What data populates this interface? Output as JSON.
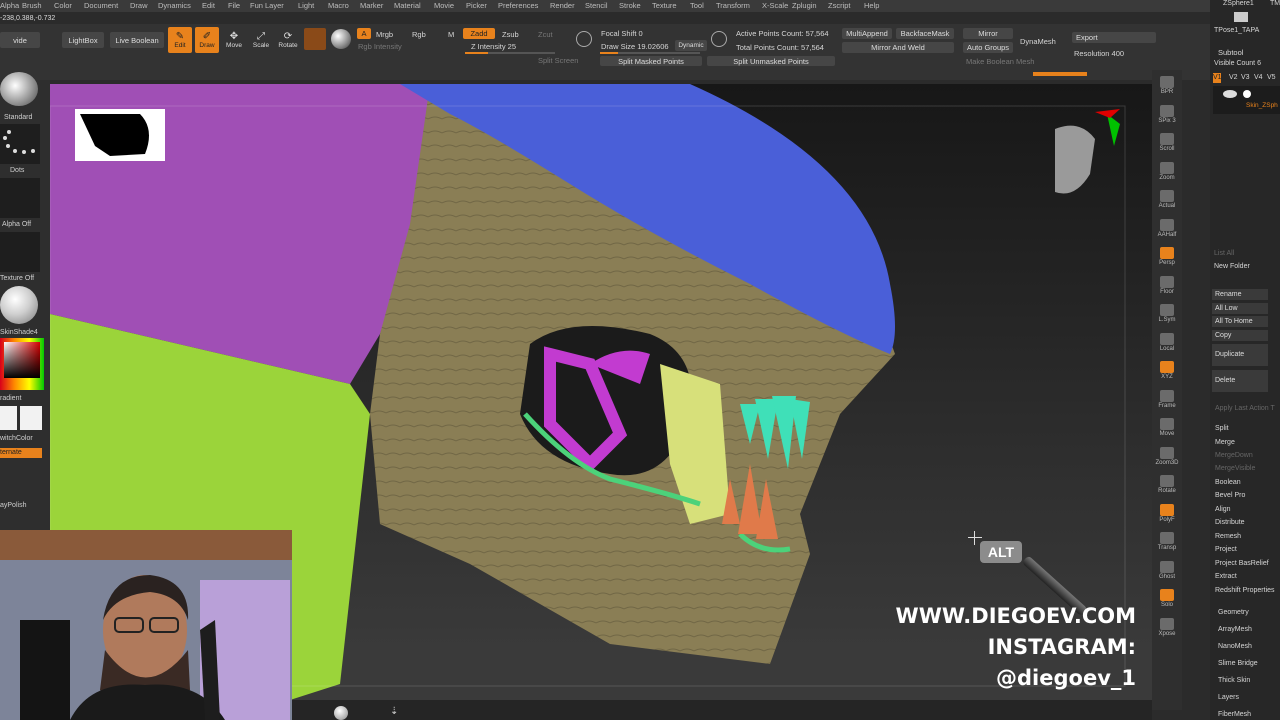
{
  "menu": [
    "Alpha",
    "Brush",
    "Color",
    "Document",
    "Draw",
    "Dynamics",
    "Edit",
    "File",
    "Fun Layer",
    "Light",
    "Macro",
    "Marker",
    "Material",
    "Movie",
    "Picker",
    "Preferences",
    "Render",
    "Stencil",
    "Stroke",
    "Texture",
    "Tool",
    "Transform",
    "X-Scale",
    "Zplugin",
    "Zscript",
    "Help"
  ],
  "coords": "-238,0.388,-0.732",
  "toolbar": {
    "divide": "vide",
    "lightbox": "LightBox",
    "live_boolean": "Live Boolean",
    "edit": "Edit",
    "draw": "Draw",
    "move": "Move",
    "scale": "Scale",
    "rotate": "Rotate",
    "a": "A",
    "mrgb": "Mrgb",
    "rgb": "Rgb",
    "m": "M",
    "rgb_intensity": "Rgb Intensity",
    "zadd": "Zadd",
    "zsub": "Zsub",
    "zcut": "Zcut",
    "z_intensity": "Z Intensity 25",
    "z_intensity_value": 0.25,
    "focal_shift": "Focal Shift 0",
    "draw_size": "Draw Size 19.02606",
    "dynamic": "Dynamic",
    "active_points": "Active Points Count: 57,564",
    "total_points": "Total Points Count: 57,564",
    "multiappend": "MultiAppend",
    "backfacemask": "BackfaceMask",
    "mirror_and_weld": "Mirror And Weld",
    "mirror": "Mirror",
    "auto_groups": "Auto Groups",
    "dynamesh": "DynaMesh",
    "export": "Export",
    "resolution": "Resolution 400",
    "split_screen": "Split Screen",
    "split_masked": "Split Masked Points",
    "split_unmasked": "Split Unmasked Points",
    "make_boolean": "Make Boolean Mesh"
  },
  "leftshelf": {
    "standard": "Standard",
    "dots": "Dots",
    "alpha_off": "Alpha Off",
    "texture_off": "Texture Off",
    "material": "SkinShade4",
    "gradient": "radient",
    "switchcolor": "witchColor",
    "alternate": "ternate",
    "polish": "ayPolish"
  },
  "rightshelf": [
    "BPR",
    "SPix 3",
    "Scroll",
    "Zoom",
    "Actual",
    "AAHalf",
    "Persp",
    "Floor",
    "L.Sym",
    "Local",
    "XYZ",
    "Frame",
    "Move",
    "Zoom3D",
    "Rotate",
    "PolyF",
    "Transp",
    "Ghost",
    "Solo",
    "Xpose"
  ],
  "rightshelf_top": "Dynamic",
  "rightpanel": {
    "zsphere": "ZSphere1",
    "tmo": "TM",
    "tpose": "TPose1_TAPA",
    "subtool": "Subtool",
    "visible_count": "Visible Count 6",
    "v_labels": [
      "V1",
      "V2",
      "V3",
      "V4",
      "V5"
    ],
    "skin_label": "Skin_ZSph",
    "list_all": "List All",
    "new_folder": "New Folder",
    "rename": "Rename",
    "all_low": "All Low",
    "all_to_home": "All To Home",
    "copy": "Copy",
    "duplicate": "Duplicate",
    "delete": "Delete",
    "apply_last_action": "Apply Last Action T",
    "split": "Split",
    "merge": "Merge",
    "merge_down": "MergeDown",
    "merge_visible": "MergeVisible",
    "boolean": "Boolean",
    "bevel_pro": "Bevel Pro",
    "align": "Align",
    "distribute": "Distribute",
    "remesh": "Remesh",
    "project": "Project",
    "project_basrelief": "Project BasRelief",
    "extract": "Extract",
    "redshift": "Redshift Properties",
    "geometry": "Geometry",
    "arraymesh": "ArrayMesh",
    "nanomesh": "NanoMesh",
    "slime_bridge": "Slime Bridge",
    "thick_skin": "Thick Skin",
    "layers": "Layers",
    "fibermesh": "FiberMesh"
  },
  "alt_badge": "ALT",
  "watermark": {
    "site": "WWW.DIEGOEV.COM",
    "instagram": "INSTAGRAM:",
    "handle": "@diegoev_1"
  },
  "colors": {
    "accent": "#e8821c",
    "polygroup_blue": "#4a5fd8",
    "polygroup_purple": "#a04fb5",
    "polygroup_tan": "#8a7e55",
    "polygroup_green": "#9bd43a",
    "polygroup_magenta": "#c23bd0",
    "teeth_cyan": "#3fe0b8",
    "teeth_orange": "#e07a4a"
  }
}
